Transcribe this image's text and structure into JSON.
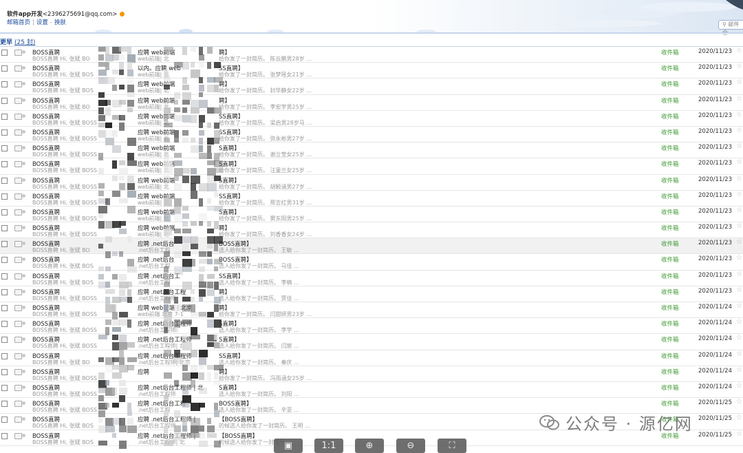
{
  "header": {
    "account_name": "软件app开发",
    "account_email": "<2396275691@qq.com>",
    "links": [
      "邮箱首页",
      "设置",
      "换肤"
    ],
    "search_placeholder": "邮件全"
  },
  "group": {
    "label": "更早",
    "count": "(25 封)"
  },
  "rows": [
    {
      "sender": "BOSS直聘",
      "preview": "BOSS直聘 Hi, 张斌 BO",
      "subject": "应聘 web前端",
      "subject2": "web前端| 北",
      "tag": "聘】",
      "snippet": "给你发了一封简历。 陈云鹏男28岁 …",
      "folder": "收件箱",
      "date": "2020/11/23"
    },
    {
      "sender": "BOSS直聘",
      "preview": "BOSS直聘 Hi, 张斌 BOS",
      "subject": "以内。应聘 web",
      "subject2": "web前端| 北",
      "tag": "SS直聘】",
      "snippet": "给你发了一封简历。 张梦瑶女21岁 …",
      "folder": "收件箱",
      "date": "2020/11/23"
    },
    {
      "sender": "BOSS直聘",
      "preview": "BOSS直聘 Hi, 张斌 BOS",
      "subject": "应聘 web前端",
      "subject2": "web前端| 北",
      "tag": "聘】",
      "snippet": "给你发了一封简历。 封华静女22岁 …",
      "folder": "收件箱",
      "date": "2020/11/23"
    },
    {
      "sender": "BOSS直聘",
      "preview": "BOSS直聘 Hi, 张斌 BO",
      "subject": "应聘 web前端",
      "subject2": "web前端| 北",
      "tag": "聘】",
      "snippet": "给你发了一封简历。 李宏宇男25岁 …",
      "folder": "收件箱",
      "date": "2020/11/23"
    },
    {
      "sender": "BOSS直聘",
      "preview": "BOSS直聘 Hi, 张斌 BOSS",
      "subject": "应聘 web前端",
      "subject2": "web前端| 北",
      "tag": "SS直聘】",
      "snippet": "给你发了一封简历。 梁启男28岁马 …",
      "folder": "收件箱",
      "date": "2020/11/23"
    },
    {
      "sender": "BOSS直聘",
      "preview": "BOSS直聘 Hi, 张斌 BOSS",
      "subject": "应聘 web前端",
      "subject2": "web前端| 北",
      "tag": "SS直聘】",
      "snippet": "给你发了一封简历。 弥永彬男27岁 …",
      "folder": "收件箱",
      "date": "2020/11/23"
    },
    {
      "sender": "BOSS直聘",
      "preview": "BOSS直聘 Hi, 张斌 BOSS",
      "subject": "应聘 web前端",
      "subject2": "web前端| 北",
      "tag": "S直聘】",
      "snippet": "给你发了一封简历。 谢立莹女25岁 …",
      "folder": "收件箱",
      "date": "2020/11/23"
    },
    {
      "sender": "BOSS直聘",
      "preview": "BOSS直聘 Hi, 张斌 BOSS",
      "subject": "应聘 web前端",
      "subject2": "web前端| 北",
      "tag": "S直聘】",
      "snippet": "给你发了一封简历。 汪童兰女25岁 …",
      "folder": "收件箱",
      "date": "2020/11/23"
    },
    {
      "sender": "BOSS直聘",
      "preview": "BOSS直聘 Hi, 张斌 BOSS",
      "subject": "应聘 web前端",
      "subject2": "web前端| 北",
      "tag": "S直聘】",
      "snippet": "给你发了一封简历。 胡颖涵男27岁 …",
      "folder": "收件箱",
      "date": "2020/11/23"
    },
    {
      "sender": "BOSS直聘",
      "preview": "BOSS直聘 Hi, 张斌 BOSS",
      "subject": "应聘 web前端",
      "subject2": "web前端| 北",
      "tag": "SS直聘】",
      "snippet": "给你发了一封简历。 邢吉红男31岁 …",
      "folder": "收件箱",
      "date": "2020/11/23"
    },
    {
      "sender": "BOSS直聘",
      "preview": "BOSS直聘 Hi, 张斌 BOSS",
      "subject": "应聘 web前端",
      "subject2": "web前端| 北",
      "tag": "S直聘】",
      "snippet": "给你发了一封简历。 窦东阳男25岁 …",
      "folder": "收件箱",
      "date": "2020/11/23"
    },
    {
      "sender": "BOSS直聘",
      "preview": "BOSS直聘 Hi, 张斌 BOSS",
      "subject": "应聘 web前端",
      "subject2": "web前端| 北",
      "tag": "聘】",
      "snippet": "给你发了一封简历。 刘香香女24岁 …",
      "folder": "收件箱",
      "date": "2020/11/23"
    },
    {
      "sender": "BOSS直聘",
      "preview": "BOSS直聘 Hi, 张斌 BO",
      "subject": "应聘 .net后台",
      "subject2": ".net后台工程",
      "tag": "BOSS直聘】",
      "snippet": "选人给你发了一封简历。 王敏 …",
      "folder": "收件箱",
      "date": "2020/11/23"
    },
    {
      "sender": "BOSS直聘",
      "preview": "BOSS直聘 Hi, 张斌 BOS",
      "subject": "应聘 .net后台",
      "subject2": ".net后台工程",
      "tag": "BOSS直聘】",
      "snippet": "选人给你发了一封简历。 马佳 …",
      "folder": "收件箱",
      "date": "2020/11/23"
    },
    {
      "sender": "BOSS直聘",
      "preview": "BOSS直聘 Hi, 张斌 BOS",
      "subject": "应聘 .net后台工",
      "subject2": ".net后台工程",
      "tag": "SS直聘】",
      "snippet": "选人给你发了一封简历。 李楠 …",
      "folder": "收件箱",
      "date": "2020/11/23"
    },
    {
      "sender": "BOSS直聘",
      "preview": "BOSS直聘 Hi, 张斌 BOSS",
      "subject": "应聘 .net后台工程",
      "subject2": ".net后台工程师",
      "tag": "聘】",
      "snippet": "选人给你发了一封简历。 贾佳 …",
      "folder": "收件箱",
      "date": "2020/11/23"
    },
    {
      "sender": "BOSS直聘",
      "preview": "BOSS直聘 Hi, 张斌 BOSS",
      "subject": "应聘 web前端 | 北京",
      "subject2": "web前端 北京 7-1",
      "tag": "聘】",
      "snippet": "给你发了一封简历。 闫甜妍男23岁 …",
      "folder": "收件箱",
      "date": "2020/11/24"
    },
    {
      "sender": "BOSS直聘",
      "preview": "BOSS直聘 Hi, 张斌 BOSS",
      "subject": "应聘 .net后台工程师",
      "subject2": ".net后台工程师",
      "tag": "S直聘】",
      "snippet": "选人给你发了一封简历。 李宇 …",
      "folder": "收件箱",
      "date": "2020/11/24"
    },
    {
      "sender": "BOSS直聘",
      "preview": "BOSS直聘 Hi, 张斌 BOSS",
      "subject": "应聘 .net后台工程师",
      "subject2": ".net后台工程师| 北",
      "tag": "S直聘】",
      "snippet": "选人给你发了一封简历。 闫宸 …",
      "folder": "收件箱",
      "date": "2020/11/24"
    },
    {
      "sender": "BOSS直聘",
      "preview": "BOSS直聘 Hi, 张斌 BO",
      "subject": "应聘 .net后台工程师",
      "subject2": ".net后台工程师| 北京",
      "tag": "SS直聘】",
      "snippet": "选人给你发了一封简历。 秦庆 …",
      "folder": "收件箱",
      "date": "2020/11/24"
    },
    {
      "sender": "BOSS直聘",
      "preview": "BOSS直聘 Hi, 张斌 BOSS",
      "subject": "应聘",
      "subject2": "",
      "tag": "聘】",
      "snippet": "给你发了一封简历。 冯雨涵女25岁 …",
      "folder": "收件箱",
      "date": "2020/11/24"
    },
    {
      "sender": "BOSS直聘",
      "preview": "BOSS直聘 Hi, 张斌 BOSS",
      "subject": "应聘 .net后台工程师 | 北",
      "subject2": ".net后台工程师",
      "tag": "S直聘】",
      "snippet": "选人给你发了一封简历。 刘阳 …",
      "folder": "收件箱",
      "date": "2020/11/24"
    },
    {
      "sender": "BOSS直聘",
      "preview": "BOSS直聘 Hi, 张斌 BOSS",
      "subject": "应聘 .net后台工程",
      "subject2": ".net后台工程",
      "tag": "BOSS直聘】",
      "snippet": "选人给你发了一封简历。 辛亚 …",
      "folder": "收件箱",
      "date": "2020/11/25"
    },
    {
      "sender": "BOSS直聘",
      "preview": "BOSS直聘 Hi, 张斌 BOS",
      "subject": "应聘 .net后台工程师 |",
      "subject2": ".net后台工程师",
      "tag": "【BOSS直聘】",
      "snippet": "的候选人给你发了一封简历。 王明 …",
      "folder": "收件箱",
      "date": "2020/11/25"
    },
    {
      "sender": "BOSS直聘",
      "preview": "BOSS直聘 Hi, 张斌 BOS",
      "subject": "应聘 .net后台工程师 |",
      "subject2": ".net后台工程师| 北",
      "tag": "【BOSS直聘】",
      "snippet": "的候选人给你发了一封简历。",
      "folder": "收件箱",
      "date": "2020/11/25"
    }
  ],
  "viewer": {
    "fit_label": "1:1"
  },
  "watermark": {
    "text": "公众号 · 源亿网"
  },
  "colors": {
    "link": "#1f4e9c",
    "folder": "#3d9a33"
  }
}
